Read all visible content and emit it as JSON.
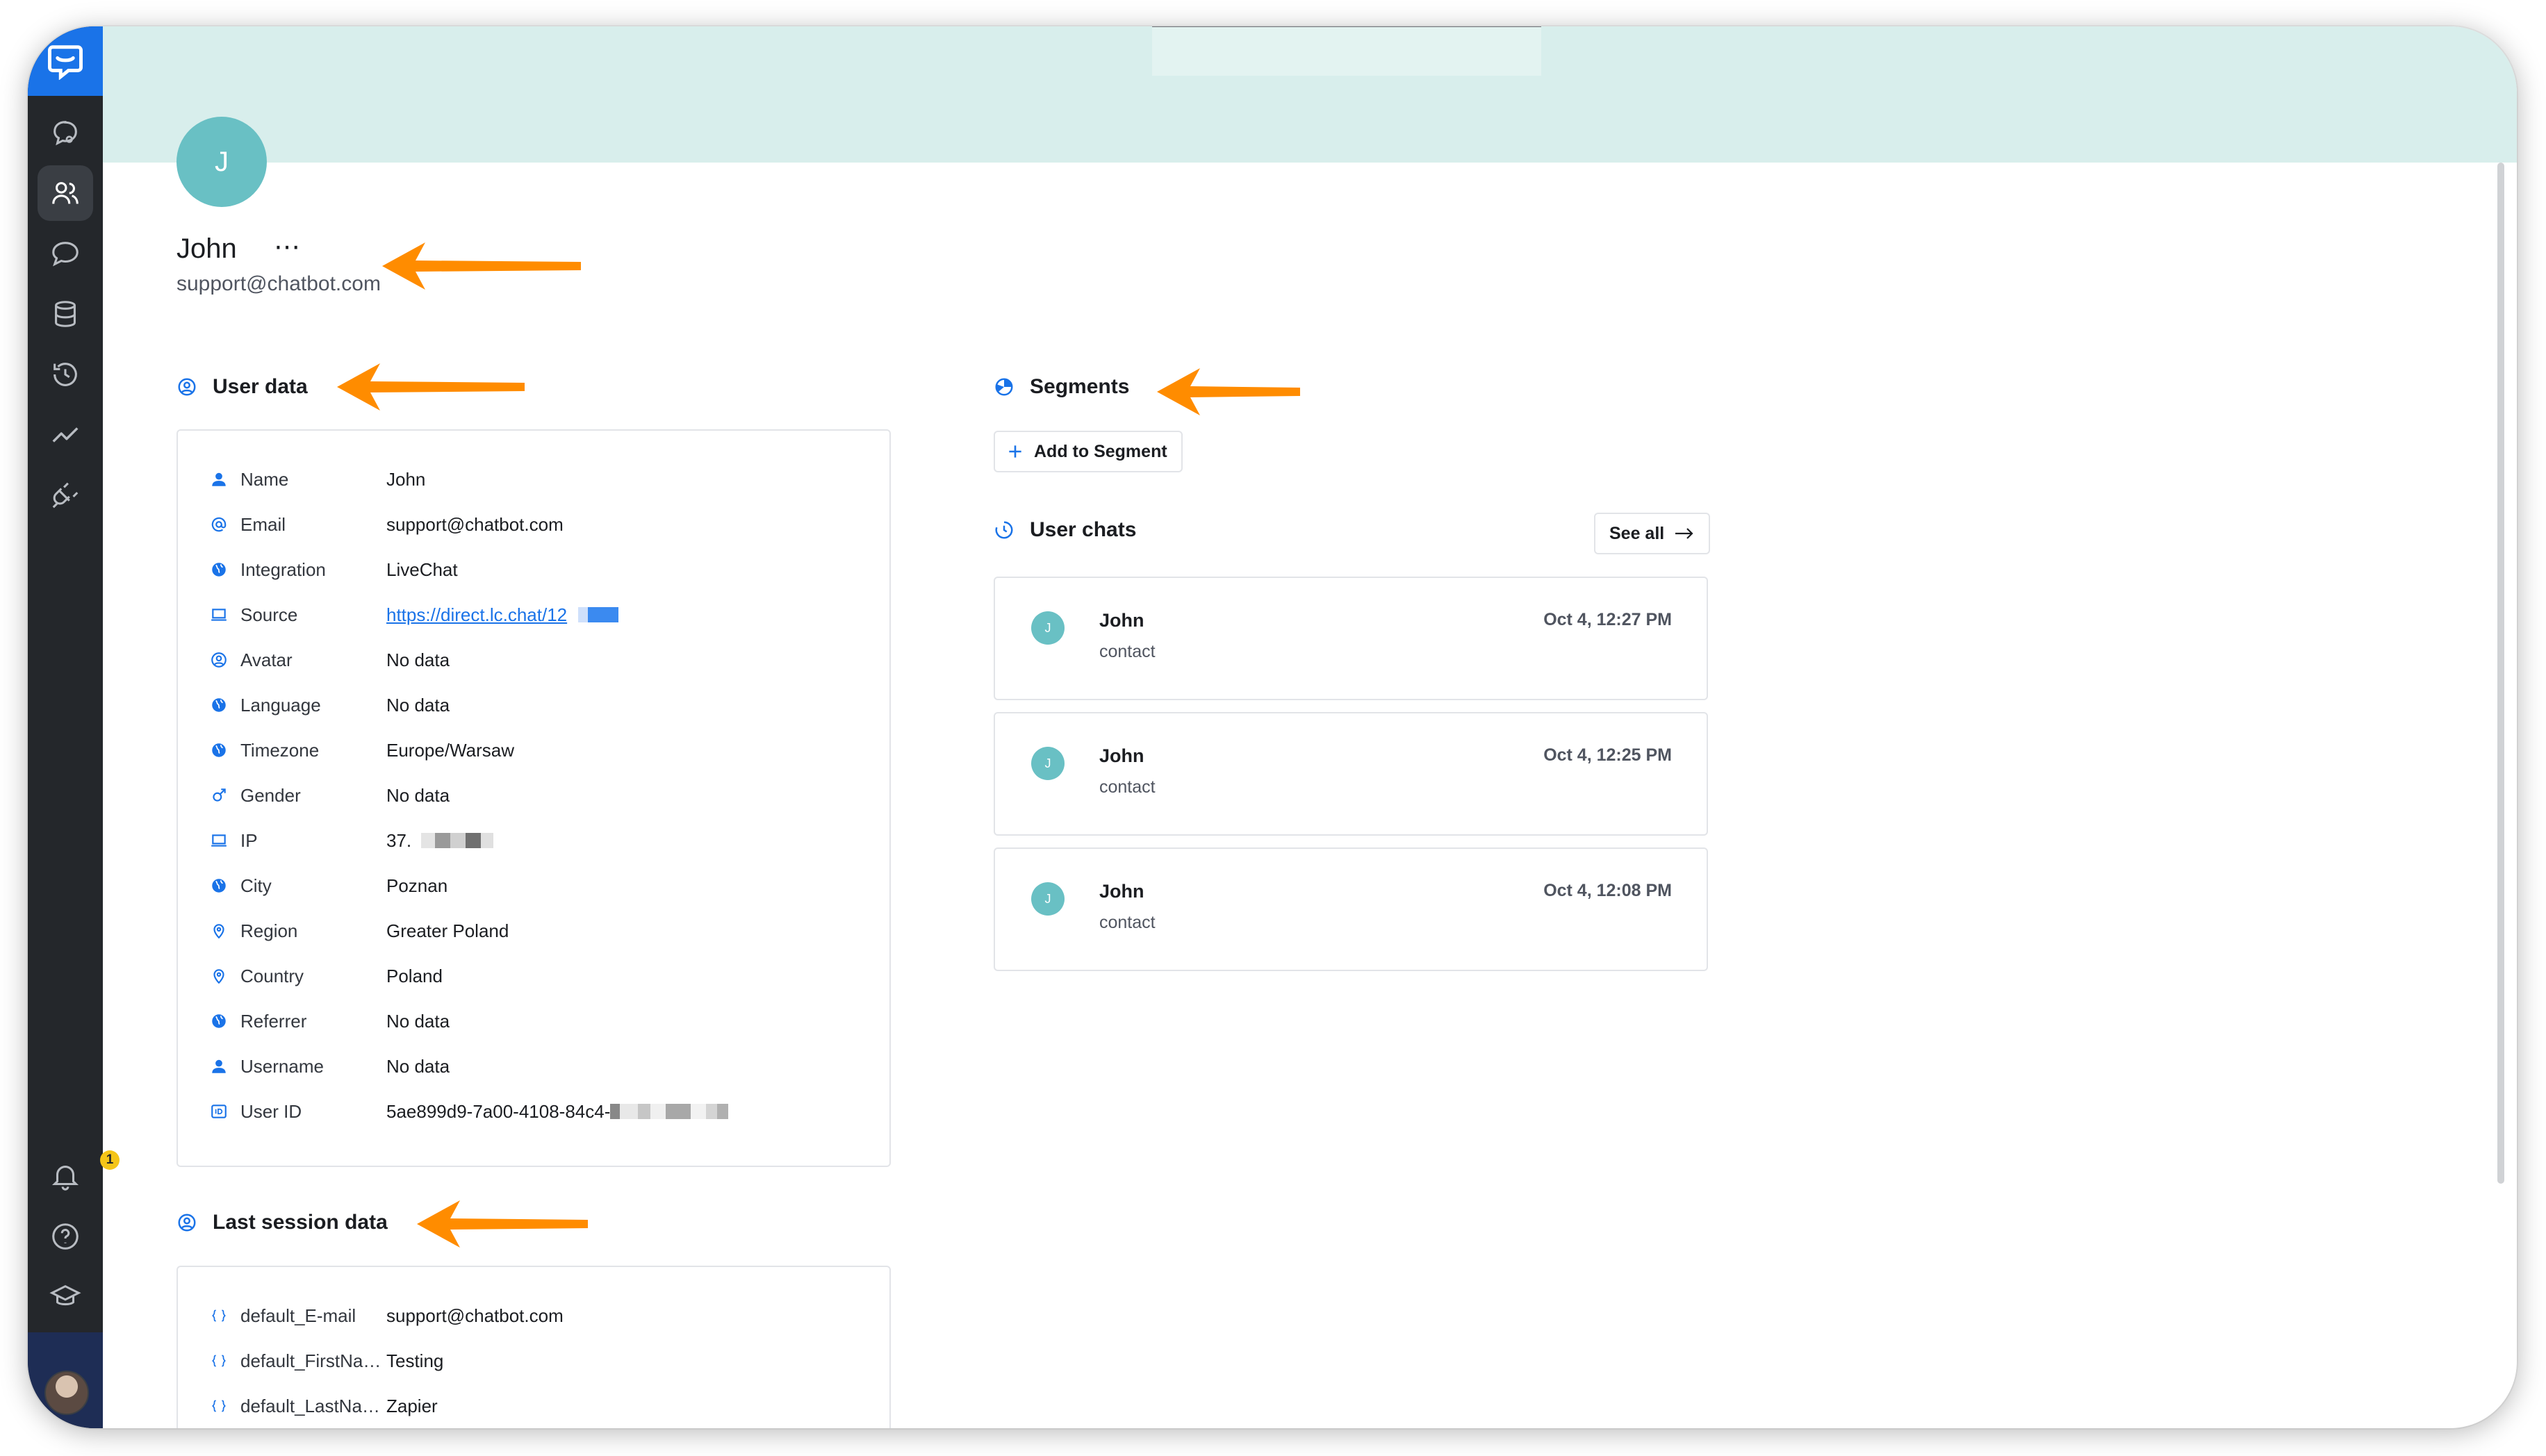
{
  "profile": {
    "initial": "J",
    "name": "John",
    "more": "⋯",
    "email": "support@chatbot.com"
  },
  "notifications": {
    "count": "1"
  },
  "user_data": {
    "title": "User data",
    "rows": [
      {
        "label": "Name",
        "value": "John",
        "icon": "person-icon"
      },
      {
        "label": "Email",
        "value": "support@chatbot.com",
        "icon": "at-icon"
      },
      {
        "label": "Integration",
        "value": "LiveChat",
        "icon": "globe-icon"
      },
      {
        "label": "Source",
        "value": "https://direct.lc.chat/12",
        "icon": "laptop-icon"
      },
      {
        "label": "Avatar",
        "value": "No data",
        "icon": "user-circle-icon"
      },
      {
        "label": "Language",
        "value": "No data",
        "icon": "globe-icon"
      },
      {
        "label": "Timezone",
        "value": "Europe/Warsaw",
        "icon": "globe-icon"
      },
      {
        "label": "Gender",
        "value": "No data",
        "icon": "gender-icon"
      },
      {
        "label": "IP",
        "value": "37.",
        "icon": "laptop-icon"
      },
      {
        "label": "City",
        "value": "Poznan",
        "icon": "globe-icon"
      },
      {
        "label": "Region",
        "value": "Greater Poland",
        "icon": "pin-icon"
      },
      {
        "label": "Country",
        "value": "Poland",
        "icon": "pin-icon"
      },
      {
        "label": "Referrer",
        "value": "No data",
        "icon": "globe-icon"
      },
      {
        "label": "Username",
        "value": "No data",
        "icon": "person-icon"
      },
      {
        "label": "User ID",
        "value": "5ae899d9-7a00-4108-84c4-",
        "icon": "id-icon"
      }
    ]
  },
  "last_session": {
    "title": "Last session data",
    "rows": [
      {
        "label": "default_E-mail",
        "value": "support@chatbot.com",
        "icon": "braces-icon"
      },
      {
        "label": "default_FirstName",
        "value": "Testing",
        "icon": "braces-icon"
      },
      {
        "label": "default_LastName",
        "value": "Zapier",
        "icon": "braces-icon"
      }
    ]
  },
  "segments": {
    "title": "Segments",
    "add_label": "Add to Segment"
  },
  "user_chats": {
    "title": "User chats",
    "see_all": "See all",
    "chats": [
      {
        "initial": "J",
        "name": "John",
        "sub": "contact",
        "time": "Oct 4, 12:27 PM"
      },
      {
        "initial": "J",
        "name": "John",
        "sub": "contact",
        "time": "Oct 4, 12:25 PM"
      },
      {
        "initial": "J",
        "name": "John",
        "sub": "contact",
        "time": "Oct 4, 12:08 PM"
      }
    ]
  },
  "colors": {
    "accent": "#1a73e8",
    "sidebar": "#24272b",
    "banner": "#d8eeec",
    "avatar": "#69c0c4",
    "annotation_arrow": "#ff8c00"
  }
}
